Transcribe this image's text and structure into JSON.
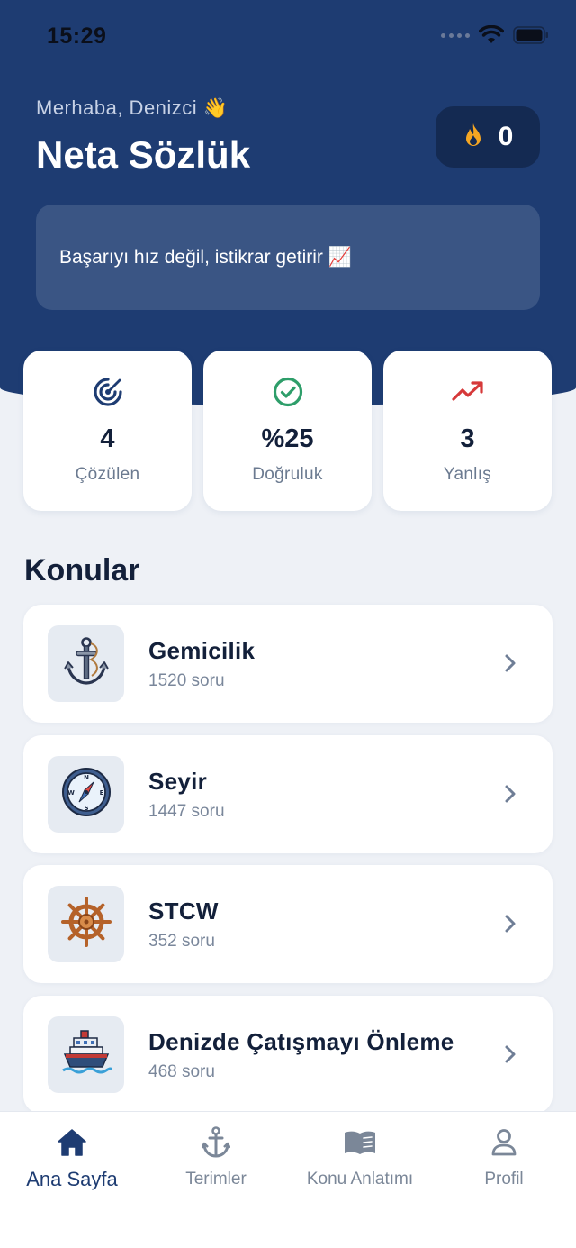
{
  "status": {
    "time": "15:29"
  },
  "header": {
    "greeting": "Merhaba, Denizci 👋",
    "title": "Neta Sözlük",
    "streak_count": "0",
    "motto": "Başarıyı hız değil, istikrar getirir 📈"
  },
  "stats": [
    {
      "value": "4",
      "label": "Çözülen",
      "icon": "target-icon",
      "color": "#1e3c72"
    },
    {
      "value": "%25",
      "label": "Doğruluk",
      "icon": "check-circle-icon",
      "color": "#2e9e6a"
    },
    {
      "value": "3",
      "label": "Yanlış",
      "icon": "trend-icon",
      "color": "#d6393a"
    }
  ],
  "section_title": "Konular",
  "topics": [
    {
      "name": "Gemicilik",
      "count": "1520 soru",
      "icon": "anchor-icon"
    },
    {
      "name": "Seyir",
      "count": "1447 soru",
      "icon": "compass-icon"
    },
    {
      "name": "STCW",
      "count": "352 soru",
      "icon": "ship-wheel-icon"
    },
    {
      "name": "Denizde Çatışmayı Önleme",
      "count": "468 soru",
      "icon": "ship-icon"
    }
  ],
  "tabs": [
    {
      "label": "Ana Sayfa",
      "icon": "home-icon",
      "active": true
    },
    {
      "label": "Terimler",
      "icon": "anchor-icon",
      "active": false
    },
    {
      "label": "Konu Anlatımı",
      "icon": "book-icon",
      "active": false
    },
    {
      "label": "Profil",
      "icon": "person-icon",
      "active": false
    }
  ],
  "colors": {
    "brand": "#1e3c72",
    "background": "#eef1f6",
    "streak_flame": "#f5a623"
  }
}
